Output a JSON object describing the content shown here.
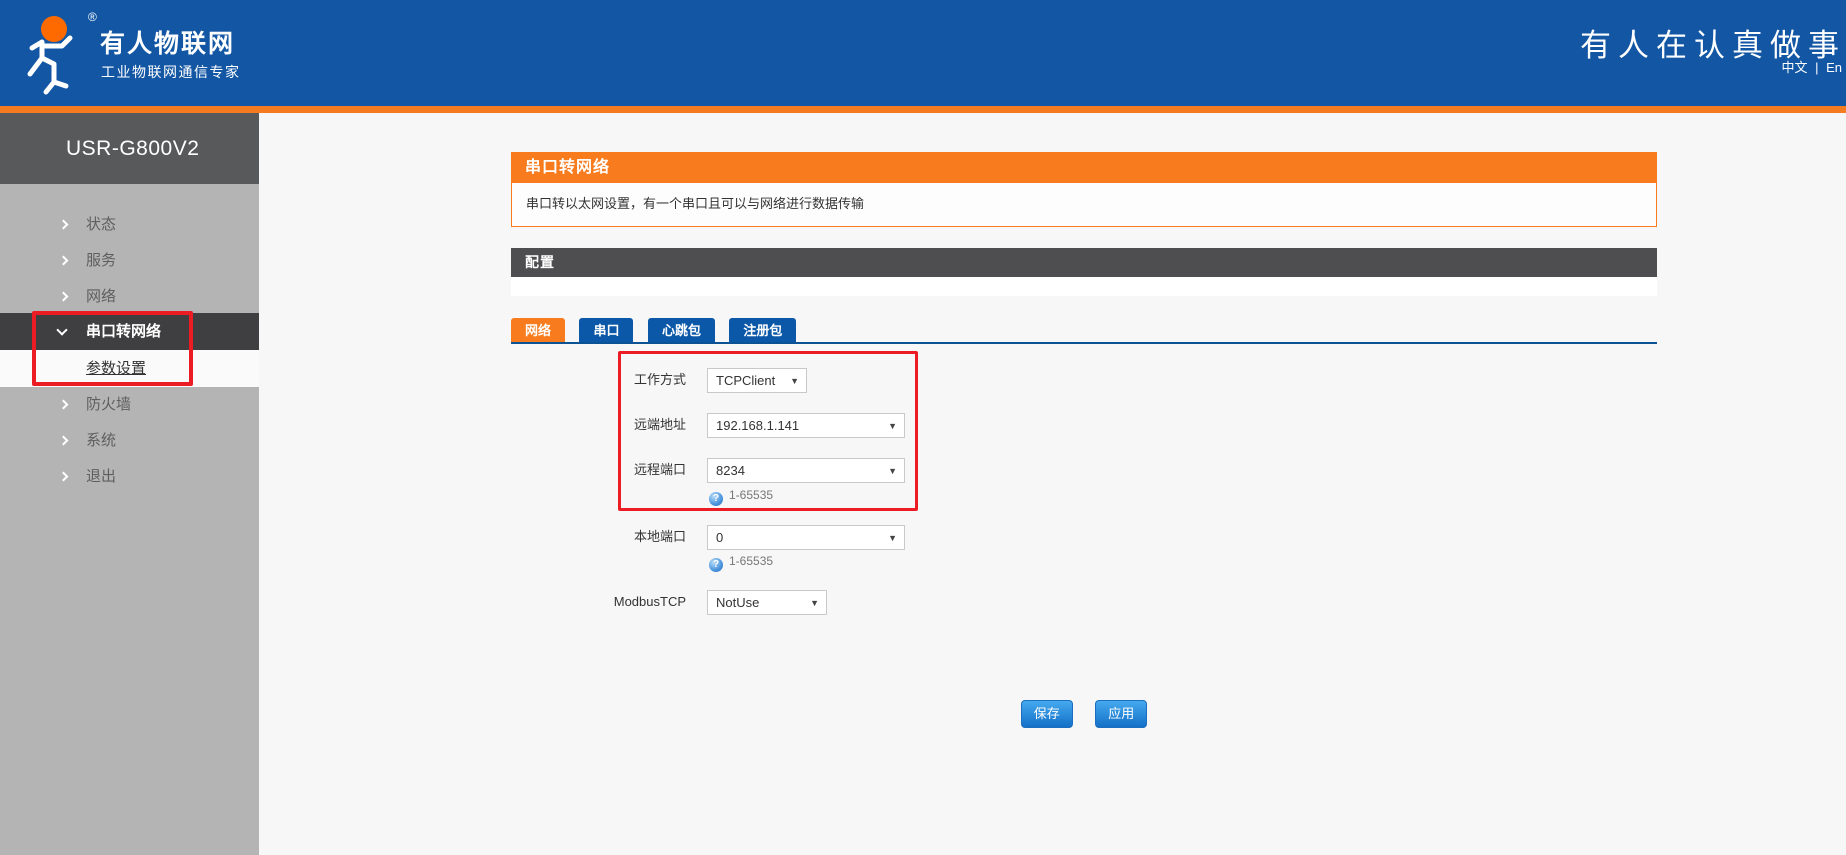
{
  "colors": {
    "header_blue": "#1256A4",
    "accent_orange": "#F87C1E",
    "tab_blue": "#0B57A8",
    "annotation_red": "#EC1C24",
    "button_blue": "#1470C8",
    "sidebar_gray": "#B4B4B4",
    "dark_bar": "#4E4E50"
  },
  "header": {
    "brand_title": "有人物联网",
    "brand_subtitle": "工业物联网通信专家",
    "registered_mark": "®",
    "slogan": "有人在认真做事",
    "language": {
      "zh": "中文",
      "separator": "|",
      "en": "En"
    }
  },
  "sidebar": {
    "device_name": "USR-G800V2",
    "items": [
      {
        "label": "状态"
      },
      {
        "label": "服务"
      },
      {
        "label": "网络"
      },
      {
        "label": "串口转网络"
      },
      {
        "label": "参数设置"
      },
      {
        "label": "防火墙"
      },
      {
        "label": "系统"
      },
      {
        "label": "退出"
      }
    ]
  },
  "main": {
    "page_title": "串口转网络",
    "page_description": "串口转以太网设置，有一个串口且可以与网络进行数据传输",
    "section_title": "配置",
    "tabs": [
      {
        "label": "网络"
      },
      {
        "label": "串口"
      },
      {
        "label": "心跳包"
      },
      {
        "label": "注册包"
      }
    ],
    "form": {
      "fields": [
        {
          "label": "工作方式",
          "value": "TCPClient"
        },
        {
          "label": "远端地址",
          "value": "192.168.1.141"
        },
        {
          "label": "远程端口",
          "value": "8234",
          "hint": "1-65535"
        },
        {
          "label": "本地端口",
          "value": "0",
          "hint": "1-65535"
        },
        {
          "label": "ModbusTCP",
          "value": "NotUse"
        }
      ]
    },
    "buttons": {
      "save": "保存",
      "apply": "应用"
    }
  },
  "icons": {
    "dropdown_arrow": "▼",
    "help": "?"
  }
}
